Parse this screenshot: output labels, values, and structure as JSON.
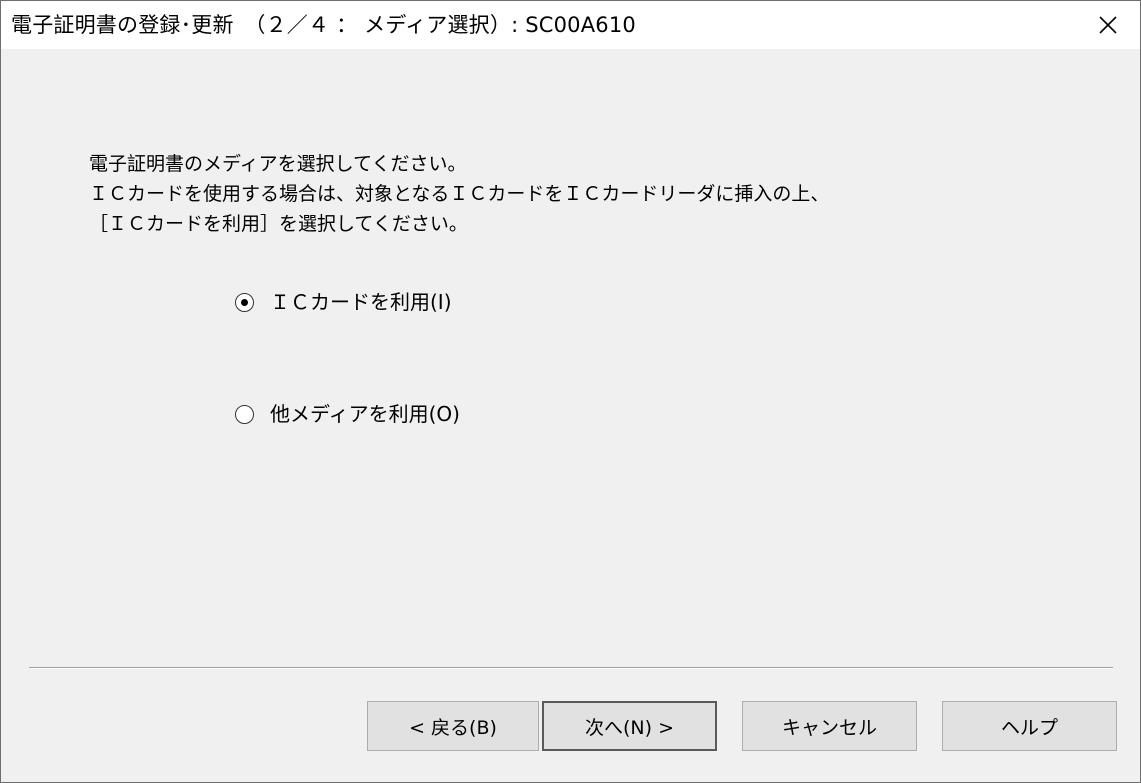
{
  "window": {
    "title": "電子証明書の登録･更新　（２／４ ： メディア選択）: SC00A610"
  },
  "instructions": {
    "line1": "電子証明書のメディアを選択してください。",
    "line2": "ＩＣカードを使用する場合は、対象となるＩＣカードをＩＣカードリーダに挿入の上、",
    "line3": "［ＩＣカードを利用］を選択してください。"
  },
  "media_options": [
    {
      "label": "ＩＣカードを利用(I)",
      "selected": true
    },
    {
      "label": "他メディアを利用(O)",
      "selected": false
    }
  ],
  "buttons": {
    "back": "< 戻る(B)",
    "next": "次へ(N) >",
    "cancel": "キャンセル",
    "help": "ヘルプ"
  },
  "icons": {
    "close": "close-icon"
  }
}
